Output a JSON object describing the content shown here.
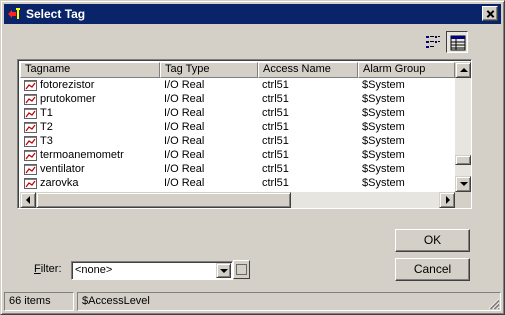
{
  "window": {
    "title": "Select Tag",
    "icons": {
      "app": "tag-app-icon",
      "close": "close-icon"
    }
  },
  "toolbar": {
    "list_view_icon": "list-view-icon",
    "details_view_icon": "details-view-icon"
  },
  "table": {
    "columns": [
      "Tagname",
      "Tag Type",
      "Access Name",
      "Alarm Group"
    ],
    "row_icon": "tag-icon",
    "rows": [
      [
        "fotorezistor",
        "I/O Real",
        "ctrl51",
        "$System"
      ],
      [
        "prutokomer",
        "I/O Real",
        "ctrl51",
        "$System"
      ],
      [
        "T1",
        "I/O Real",
        "ctrl51",
        "$System"
      ],
      [
        "T2",
        "I/O Real",
        "ctrl51",
        "$System"
      ],
      [
        "T3",
        "I/O Real",
        "ctrl51",
        "$System"
      ],
      [
        "termoanemometr",
        "I/O Real",
        "ctrl51",
        "$System"
      ],
      [
        "ventilator",
        "I/O Real",
        "ctrl51",
        "$System"
      ],
      [
        "zarovka",
        "I/O Real",
        "ctrl51",
        "$System"
      ]
    ],
    "vscroll_position": 0.88
  },
  "buttons": {
    "ok": "OK",
    "cancel": "Cancel"
  },
  "filter": {
    "label_accel": "F",
    "label_rest": "ilter:",
    "value": "<none>"
  },
  "status": {
    "item_count": "66 items",
    "field": "$AccessLevel"
  }
}
